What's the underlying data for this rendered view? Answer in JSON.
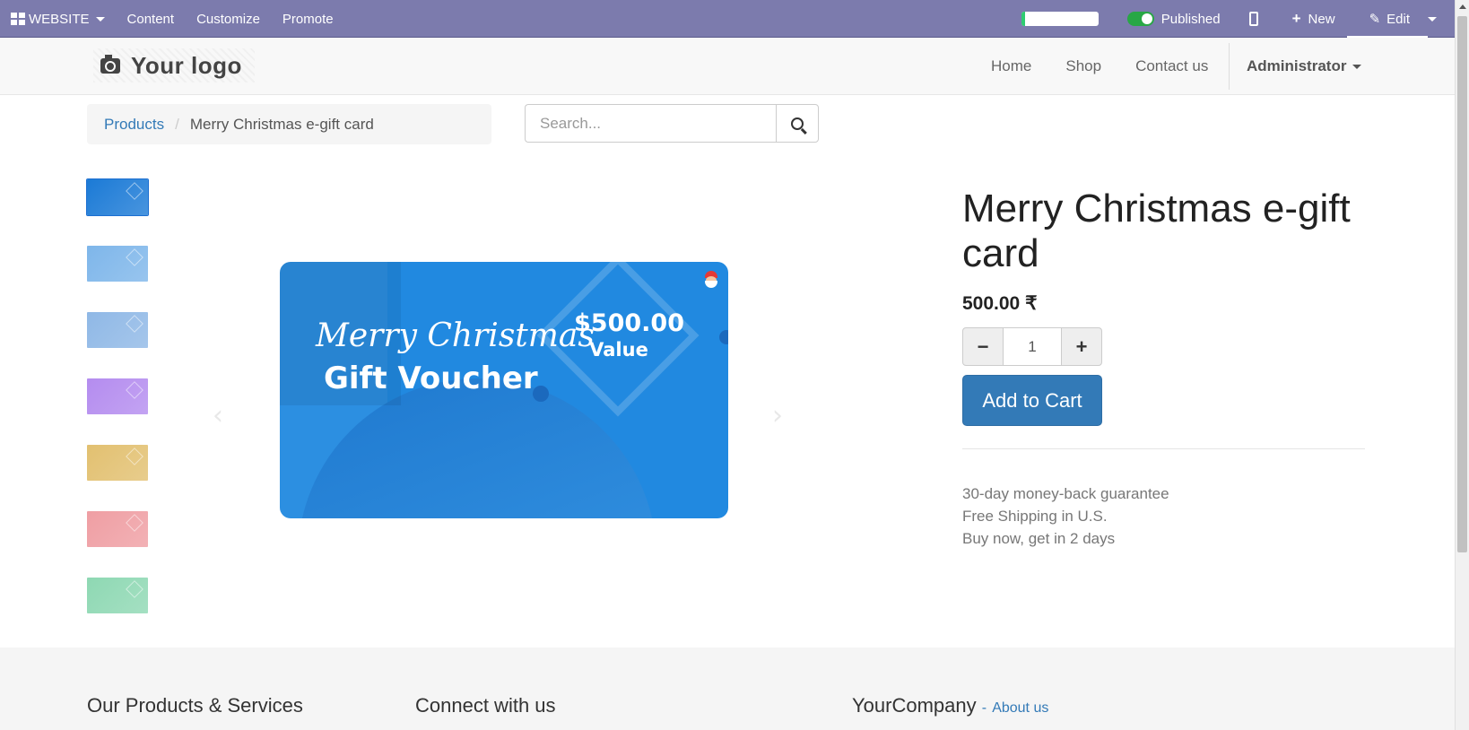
{
  "adminbar": {
    "website_label": "WEBSITE",
    "menu": [
      "Content",
      "Customize",
      "Promote"
    ],
    "progress_fraction": 0.05,
    "published_label": "Published",
    "published": true,
    "new_label": "New",
    "edit_label": "Edit"
  },
  "header": {
    "logo_text": "Your logo",
    "nav": [
      "Home",
      "Shop",
      "Contact us"
    ],
    "user_label": "Administrator"
  },
  "breadcrumb": {
    "parent": "Products",
    "current": "Merry Christmas e-gift card"
  },
  "search": {
    "placeholder": "Search..."
  },
  "thumbnails": {
    "colors": [
      "#1b7ad6",
      "#7eb6ea",
      "#8fb8e6",
      "#b48cef",
      "#e2c070",
      "#ef9ea3",
      "#8ed8b3"
    ]
  },
  "voucher": {
    "script_text": "Merry Christmas",
    "title": "Gift Voucher",
    "amount": "$500.00",
    "value_label": "Value"
  },
  "product": {
    "name": "Merry Christmas e-gift card",
    "price": "500.00 ₹",
    "quantity": "1",
    "add_to_cart": "Add to Cart",
    "guarantees": [
      "30-day money-back guarantee",
      "Free Shipping in U.S.",
      "Buy now, get in 2 days"
    ]
  },
  "footer": {
    "col1_title": "Our Products & Services",
    "col2_title": "Connect with us",
    "col3_title": "YourCompany",
    "col3_dash": "-",
    "col3_link": "About us"
  },
  "colors": {
    "adminbar_bg": "#7c7bad",
    "primary": "#337ab7",
    "toggle_on": "#28a745",
    "voucher_blue": "#2189e0"
  }
}
